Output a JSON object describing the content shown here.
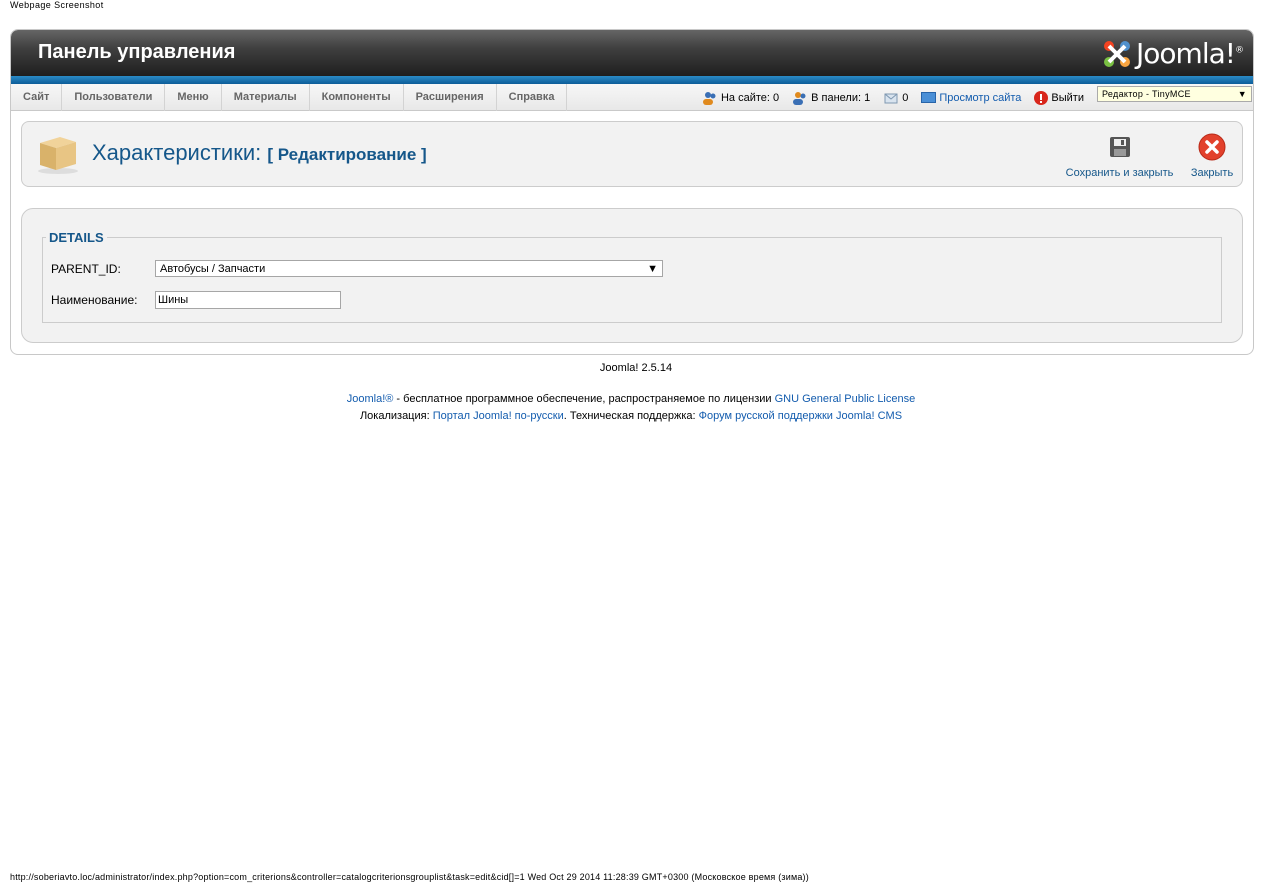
{
  "screenshot_label": "Webpage Screenshot",
  "header": {
    "title": "Панель управления",
    "logo_text": "Joomla!",
    "logo_reg": "®"
  },
  "menu": [
    {
      "label": "Сайт"
    },
    {
      "label": "Пользователи"
    },
    {
      "label": "Меню"
    },
    {
      "label": "Материалы"
    },
    {
      "label": "Компоненты"
    },
    {
      "label": "Расширения"
    },
    {
      "label": "Справка"
    }
  ],
  "status": {
    "on_site": "На сайте: 0",
    "in_panel": "В панели: 1",
    "messages": "0",
    "view_site": "Просмотр сайта",
    "logout": "Выйти",
    "editor": "Редактор - TinyMCE"
  },
  "toolbar": {
    "title": "Характеристики:",
    "subtitle": "[ Редактирование ]",
    "save_close": "Сохранить и закрыть",
    "close": "Закрыть"
  },
  "form": {
    "legend": "DETAILS",
    "parent_label": "PARENT_ID:",
    "parent_value": "Автобусы / Запчасти",
    "name_label": "Наименование:",
    "name_value": "Шины"
  },
  "footer": {
    "version": "Joomla! 2.5.14",
    "joomla_link": "Joomla!®",
    "license_text": " - бесплатное программное обеспечение, распространяемое по лицензии ",
    "license_link": "GNU General Public License",
    "loc_label": "Локализация: ",
    "loc_link": "Портал Joomla! по-русски",
    "support_label": ". Техническая поддержка: ",
    "support_link": "Форум русской поддержки Joomla! CMS"
  },
  "status_url": "http://soberiavto.loc/administrator/index.php?option=com_criterions&controller=catalogcriterionsgrouplist&task=edit&cid[]=1 Wed Oct 29 2014 11:28:39 GMT+0300 (Московское время (зима))",
  "colors": {
    "accent": "#15578a",
    "link": "#135cae",
    "header_dark": "#1e1e1e",
    "strip_blue": "#1478b8"
  }
}
